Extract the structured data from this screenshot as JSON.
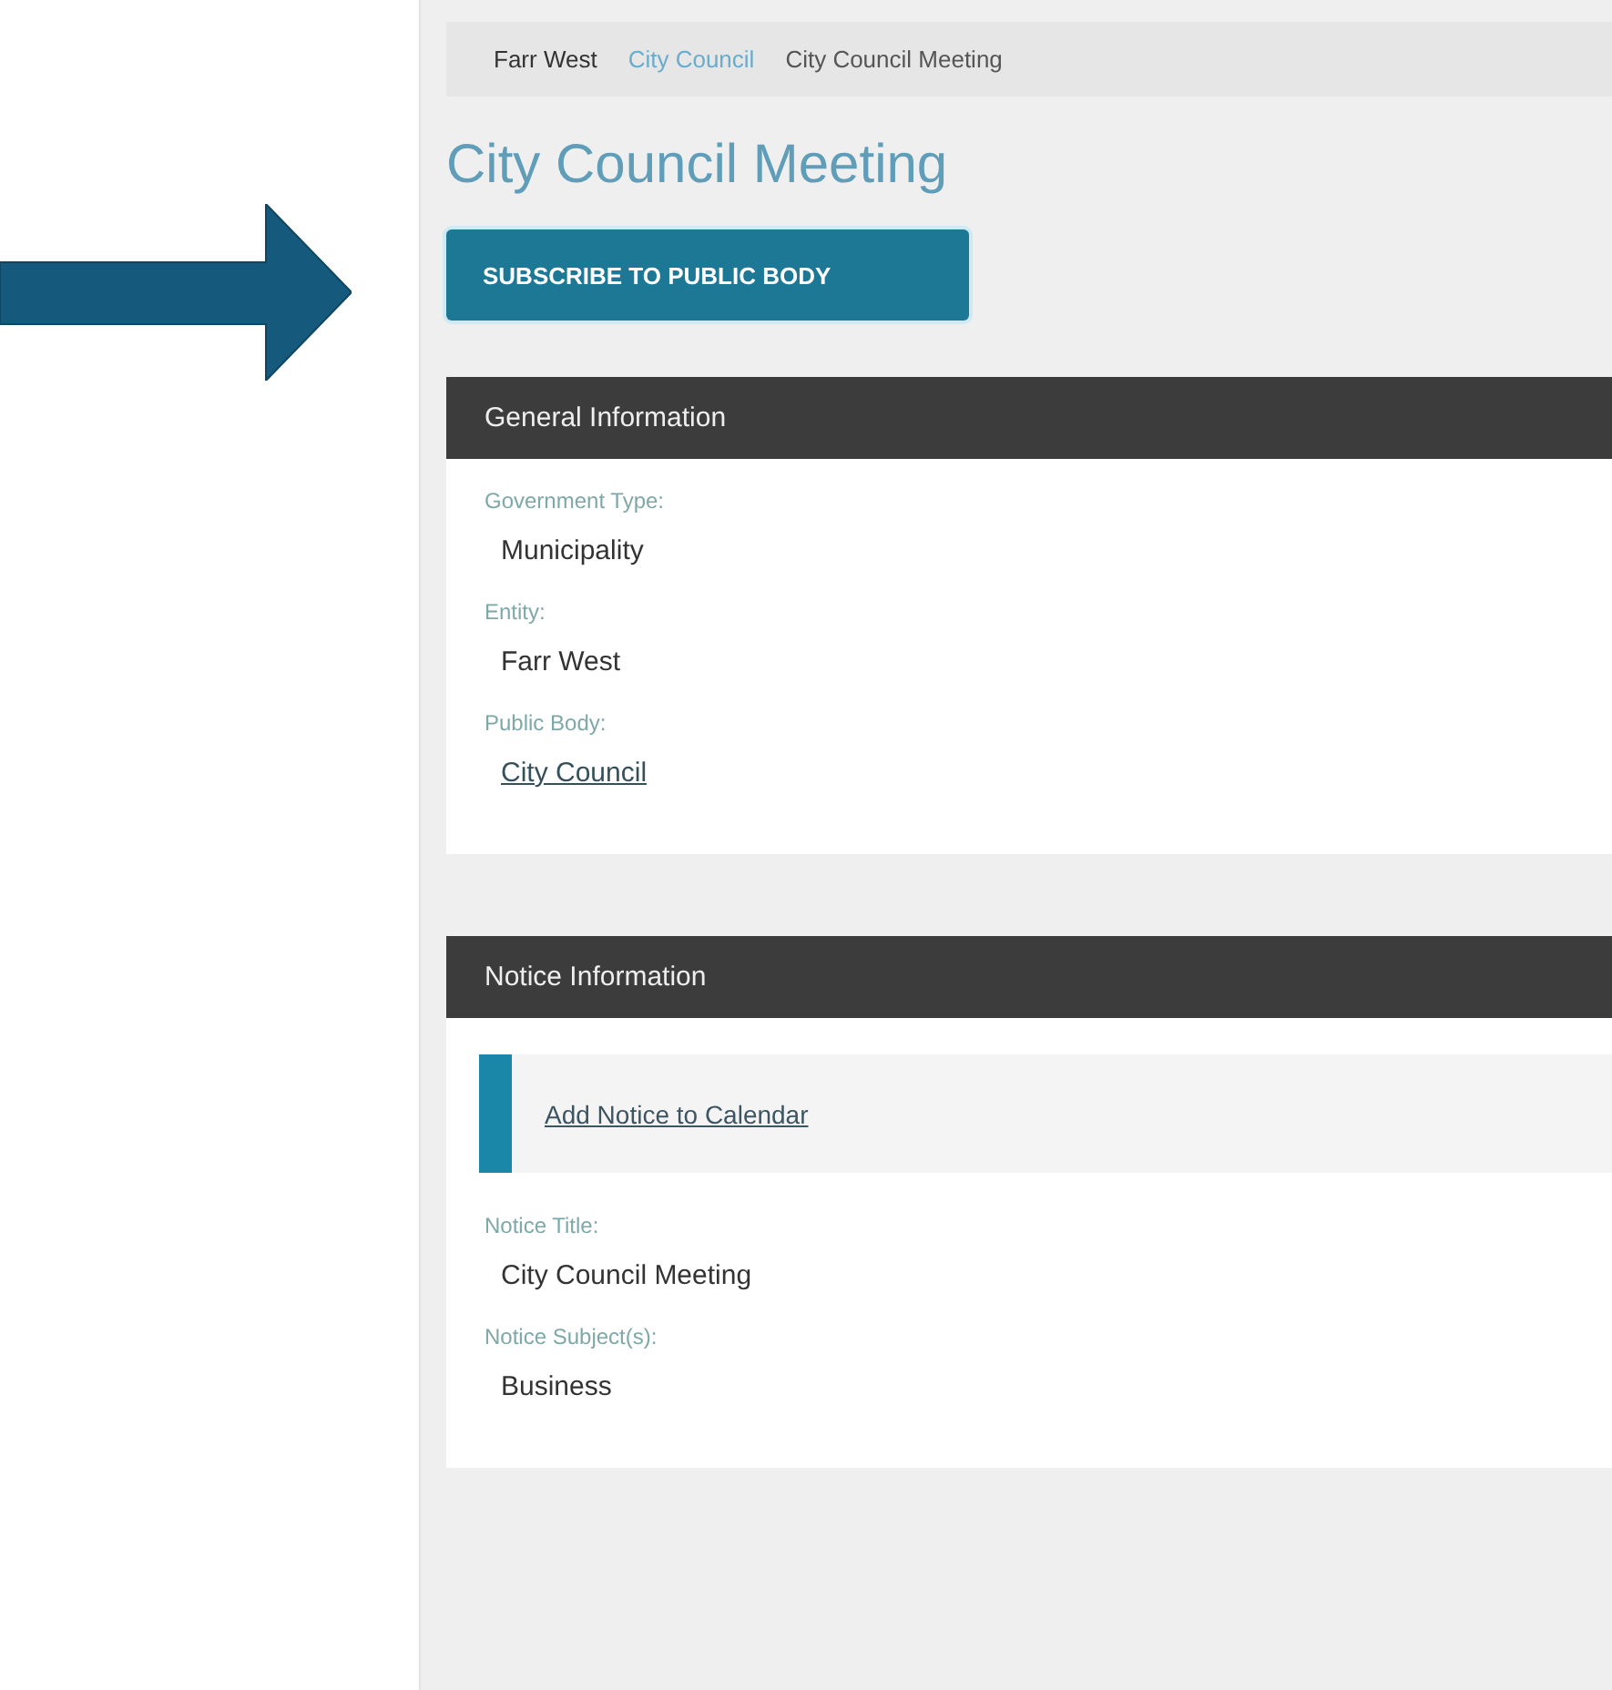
{
  "breadcrumb": [
    {
      "label": "Farr West",
      "kind": "root"
    },
    {
      "label": "City Council",
      "kind": "link"
    },
    {
      "label": "City Council Meeting",
      "kind": "current"
    }
  ],
  "title": "City Council Meeting",
  "subscribe_button": "SUBSCRIBE TO PUBLIC BODY",
  "sections": [
    {
      "header": "General Information",
      "fields": [
        {
          "label": "Government Type:",
          "value": "Municipality",
          "kind": "text"
        },
        {
          "label": "Entity:",
          "value": "Farr West",
          "kind": "text"
        },
        {
          "label": "Public Body:",
          "value": "City Council",
          "kind": "link"
        }
      ]
    },
    {
      "header": "Notice Information",
      "callout_link": "Add Notice to Calendar",
      "fields": [
        {
          "label": "Notice Title:",
          "value": "City Council Meeting",
          "kind": "text"
        },
        {
          "label": "Notice Subject(s):",
          "value": "Business",
          "kind": "text"
        }
      ]
    }
  ]
}
